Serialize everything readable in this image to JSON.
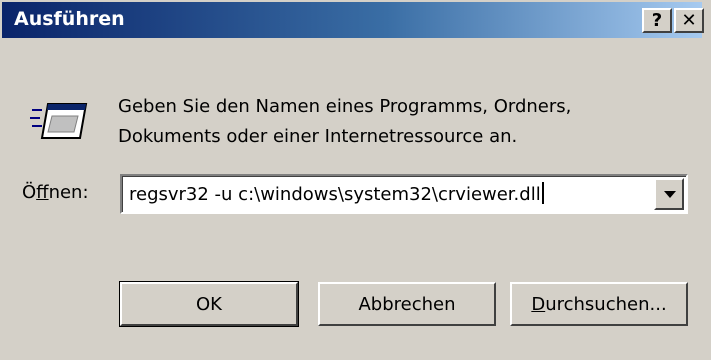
{
  "window": {
    "title": "Ausführen",
    "help_label": "?",
    "close_label": "✕"
  },
  "description": {
    "line1": "Geben Sie den Namen eines Programms, Ordners,",
    "line2": "Dokuments oder einer Internetressource an."
  },
  "open": {
    "label_prefix": "Ö",
    "label_access": "f",
    "label_suffix": "fnen:",
    "value": "regsvr32 -u c:\\windows\\system32\\crviewer.dll"
  },
  "buttons": {
    "ok": "OK",
    "cancel": "Abbrechen",
    "browse_access": "D",
    "browse_rest": "urchsuchen..."
  },
  "icons": {
    "run": "run-program-icon",
    "dropdown": "dropdown-arrow-icon"
  },
  "colors": {
    "titlebar_start": "#0a246a",
    "titlebar_end": "#a6caf0",
    "dialog_bg": "#d4d0c8"
  }
}
